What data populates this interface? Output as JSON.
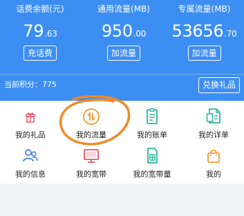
{
  "header": {
    "stats": [
      {
        "label": "话费余额(元)",
        "value_int": "79",
        "value_dec": ".63",
        "button": "充话费"
      },
      {
        "label": "通用流量(MB)",
        "value_int": "950",
        "value_dec": ".00",
        "button": "加流量"
      },
      {
        "label": "专属流量(MB)",
        "value_int": "53656",
        "value_dec": ".70",
        "button": "加流量"
      }
    ],
    "points_text": "当前积分：775",
    "redeem_button": "兑换礼品"
  },
  "grid": [
    {
      "label": "我的礼品",
      "icon": "gift-icon"
    },
    {
      "label": "我的流量",
      "icon": "data-traffic-icon"
    },
    {
      "label": "我的账单",
      "icon": "bill-icon"
    },
    {
      "label": "我的详单",
      "icon": "detail-list-icon"
    },
    {
      "label": "我的信息",
      "icon": "user-info-icon"
    },
    {
      "label": "我的宽带",
      "icon": "broadband-monitor-icon"
    },
    {
      "label": "我的宽带量",
      "icon": "sim-card-icon"
    },
    {
      "label": "我的",
      "icon": "shopping-bag-icon"
    }
  ],
  "colors": {
    "header_blue": "#3d8ef2",
    "annotation_orange": "#f08a24",
    "gift_red": "#e8546a",
    "teal": "#2ab39a",
    "blue": "#3b7de8",
    "purple": "#7b5fd6",
    "orange": "#f19a2a"
  }
}
